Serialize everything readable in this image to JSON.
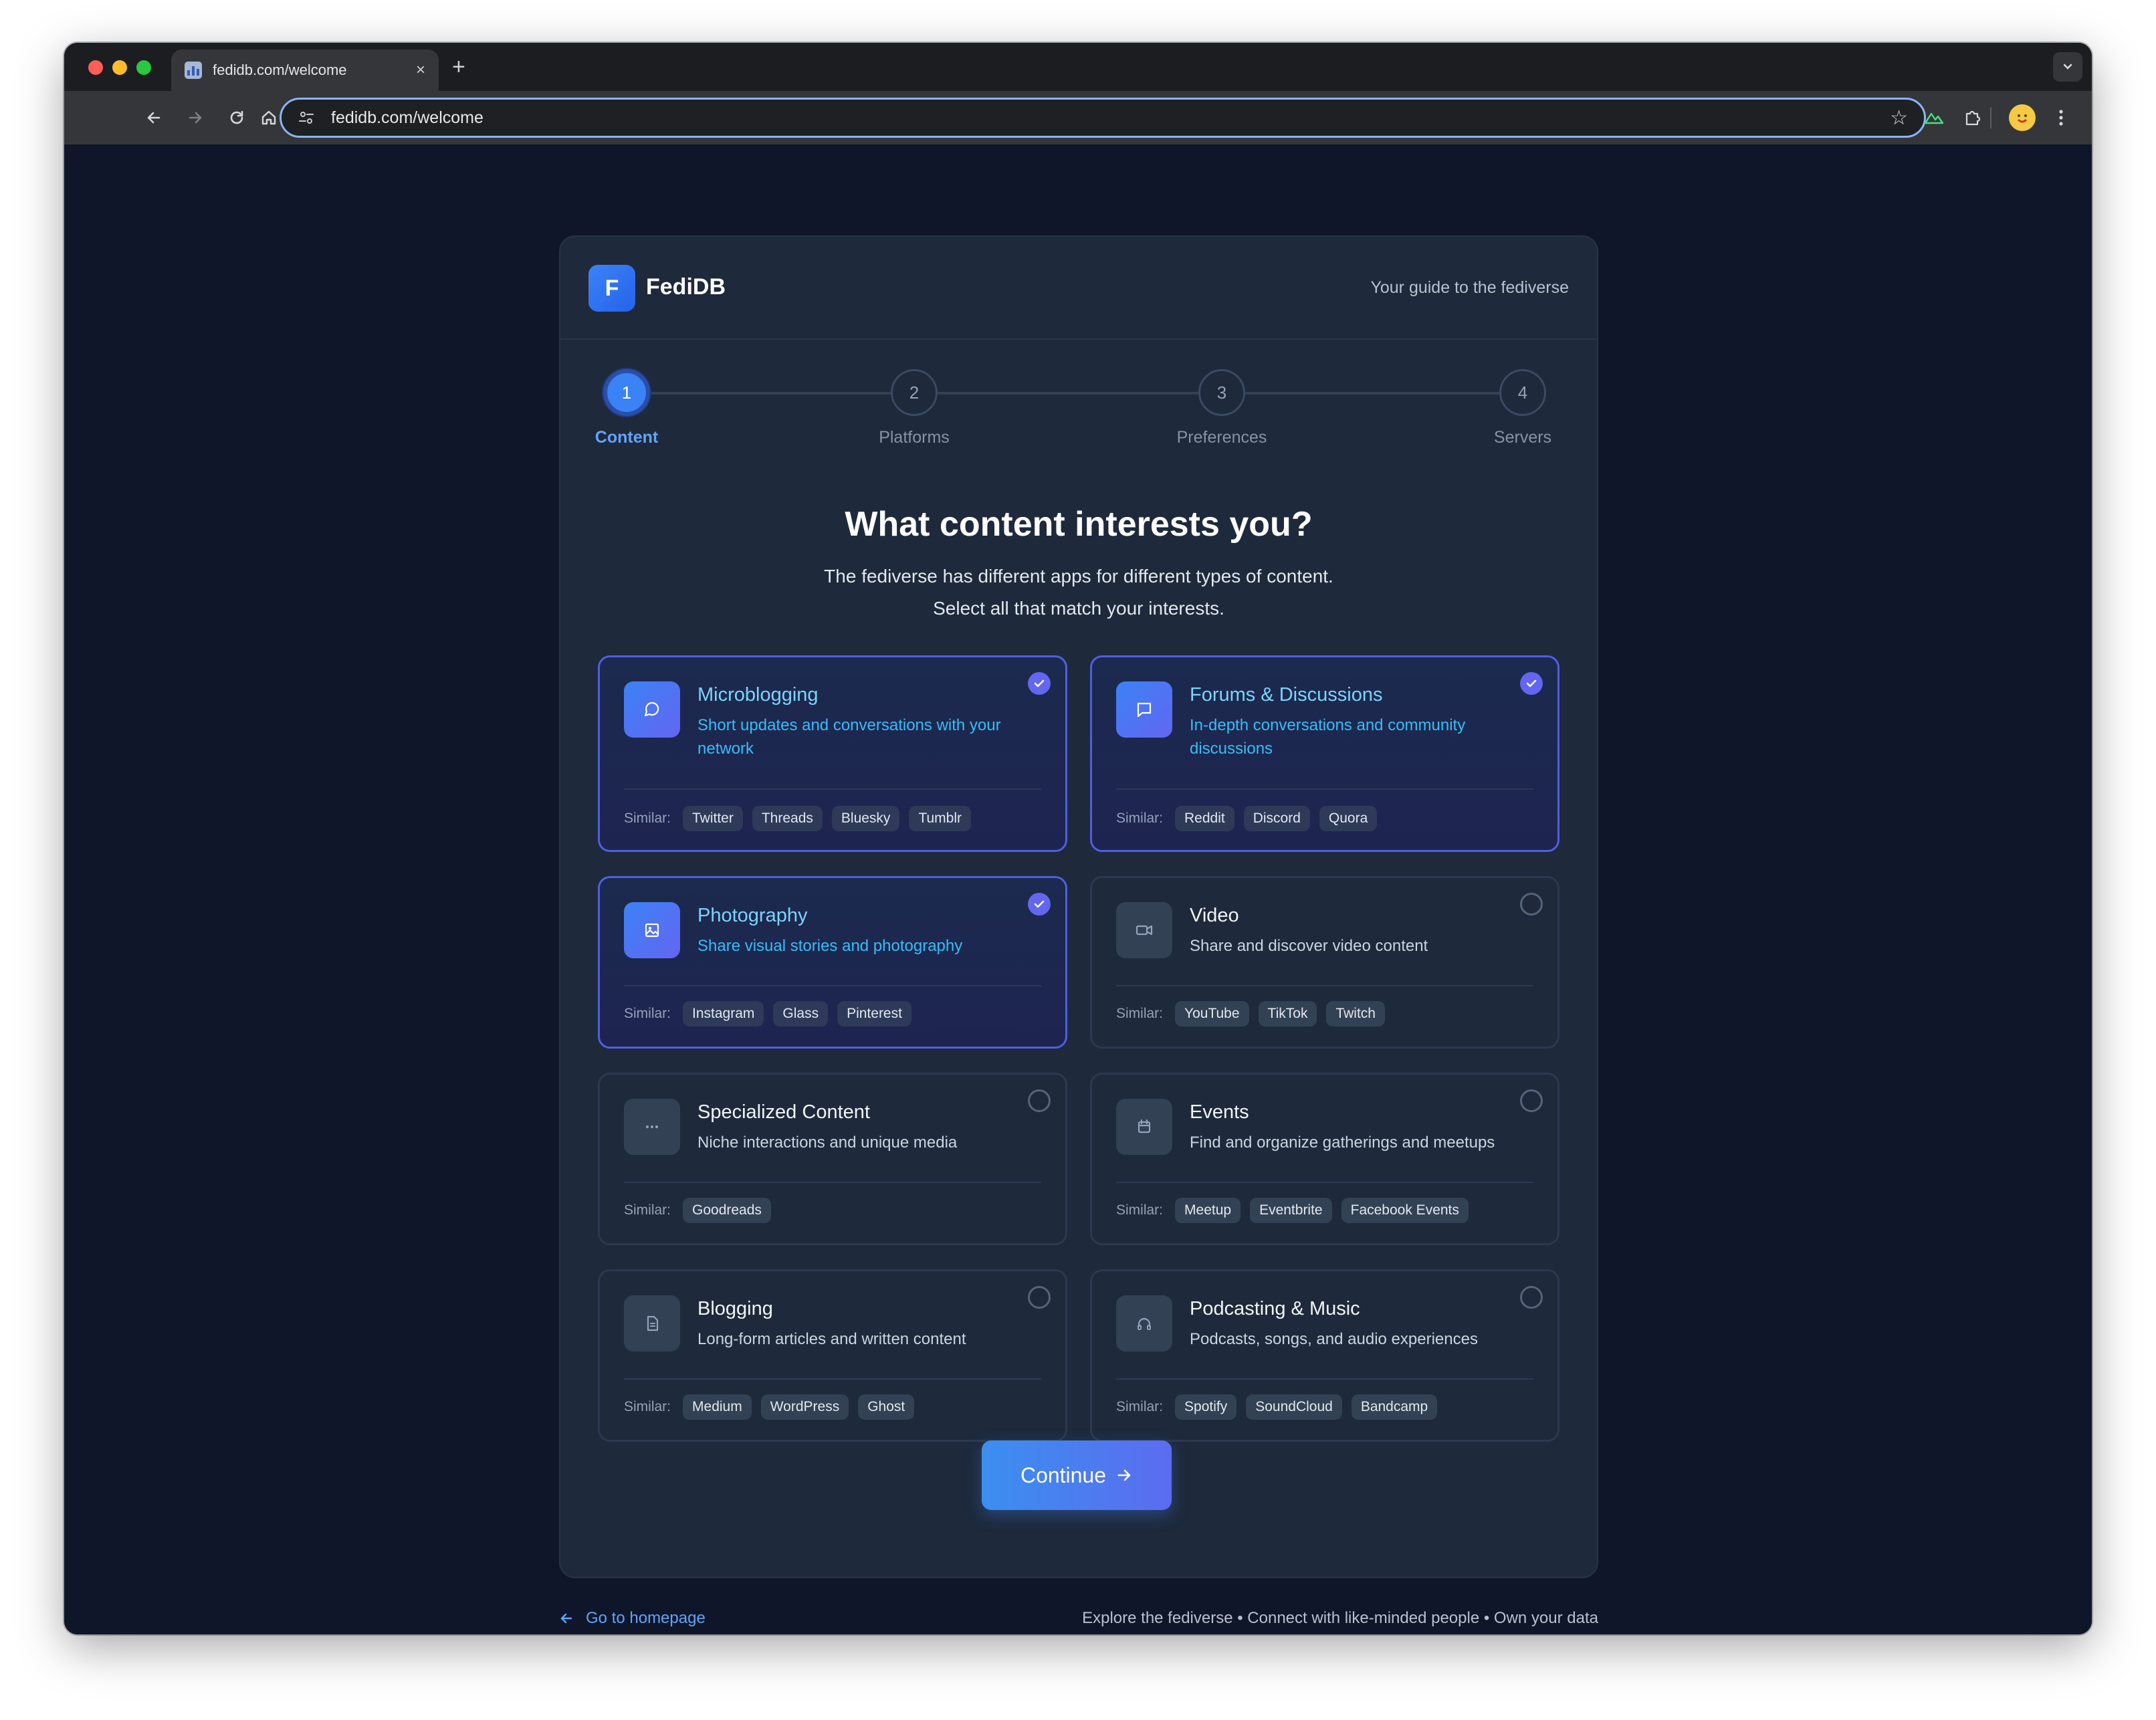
{
  "browser": {
    "tab_title": "fedidb.com/welcome",
    "tab_close": "×",
    "new_tab": "+",
    "url": "fedidb.com/welcome"
  },
  "header": {
    "logo_letter": "F",
    "brand": "FediDB",
    "tagline": "Your guide to the fediverse"
  },
  "steps": [
    {
      "number": "1",
      "label": "Content",
      "active": true
    },
    {
      "number": "2",
      "label": "Platforms",
      "active": false
    },
    {
      "number": "3",
      "label": "Preferences",
      "active": false
    },
    {
      "number": "4",
      "label": "Servers",
      "active": false
    }
  ],
  "main": {
    "title": "What content interests you?",
    "subtitle_line1": "The fediverse has different apps for different types of content.",
    "subtitle_line2": "Select all that match your interests.",
    "similar_label": "Similar:"
  },
  "options": [
    {
      "icon": "chat-bubble-icon",
      "title": "Microblogging",
      "desc": "Short updates and conversations with your network",
      "selected": true,
      "similar": [
        "Twitter",
        "Threads",
        "Bluesky",
        "Tumblr"
      ]
    },
    {
      "icon": "message-square-icon",
      "title": "Forums & Discussions",
      "desc": "In-depth conversations and community discussions",
      "selected": true,
      "similar": [
        "Reddit",
        "Discord",
        "Quora"
      ]
    },
    {
      "icon": "image-icon",
      "title": "Photography",
      "desc": "Share visual stories and photography",
      "selected": true,
      "similar": [
        "Instagram",
        "Glass",
        "Pinterest"
      ]
    },
    {
      "icon": "video-camera-icon",
      "title": "Video",
      "desc": "Share and discover video content",
      "selected": false,
      "similar": [
        "YouTube",
        "TikTok",
        "Twitch"
      ]
    },
    {
      "icon": "ellipsis-icon",
      "title": "Specialized Content",
      "desc": "Niche interactions and unique media",
      "selected": false,
      "similar": [
        "Goodreads"
      ]
    },
    {
      "icon": "calendar-icon",
      "title": "Events",
      "desc": "Find and organize gatherings and meetups",
      "selected": false,
      "similar": [
        "Meetup",
        "Eventbrite",
        "Facebook Events"
      ]
    },
    {
      "icon": "document-icon",
      "title": "Blogging",
      "desc": "Long-form articles and written content",
      "selected": false,
      "similar": [
        "Medium",
        "WordPress",
        "Ghost"
      ]
    },
    {
      "icon": "headphones-icon",
      "title": "Podcasting & Music",
      "desc": "Podcasts, songs, and audio experiences",
      "selected": false,
      "similar": [
        "Spotify",
        "SoundCloud",
        "Bandcamp"
      ]
    }
  ],
  "actions": {
    "continue_label": "Continue"
  },
  "footer": {
    "home_link": "Go to homepage",
    "tagline": "Explore the fediverse • Connect with like-minded people • Own your data"
  },
  "colors": {
    "accent": "#3b82f6",
    "selected_border": "#4f5fe0",
    "background": "#0f1629",
    "card": "#1e293b"
  }
}
